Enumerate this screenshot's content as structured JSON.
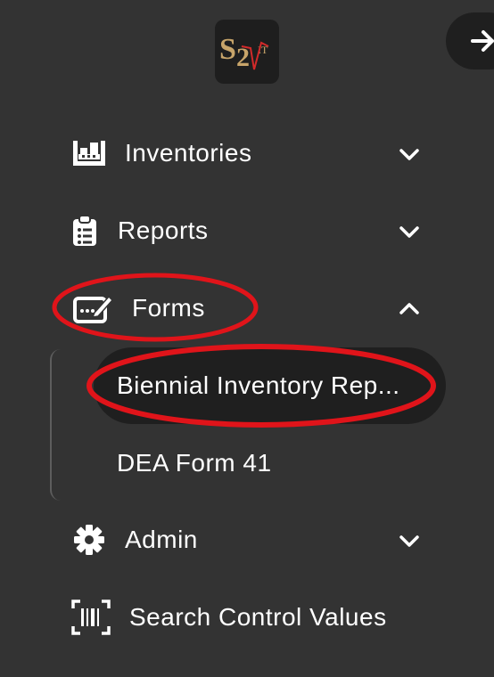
{
  "colors": {
    "background": "#333333",
    "active_item": "#1f1f1f",
    "annotation_red": "#e0141a",
    "logo_gold": "#c8a56a",
    "logo_red": "#d22a2a"
  },
  "logo": {
    "alt": "S2"
  },
  "collapse_button": {
    "icon": "arrow-right-icon"
  },
  "nav": {
    "inventories": {
      "label": "Inventories",
      "icon": "inventory-icon"
    },
    "reports": {
      "label": "Reports",
      "icon": "clipboard-list-icon"
    },
    "forms": {
      "label": "Forms",
      "icon": "edit-form-icon",
      "expanded": true,
      "children": [
        {
          "label": "Biennial Inventory Rep...",
          "active": true
        },
        {
          "label": "DEA Form 41",
          "active": false
        }
      ]
    },
    "admin": {
      "label": "Admin",
      "icon": "gear-icon"
    },
    "search_control_values": {
      "label": "Search Control Values",
      "icon": "barcode-scan-icon"
    }
  }
}
